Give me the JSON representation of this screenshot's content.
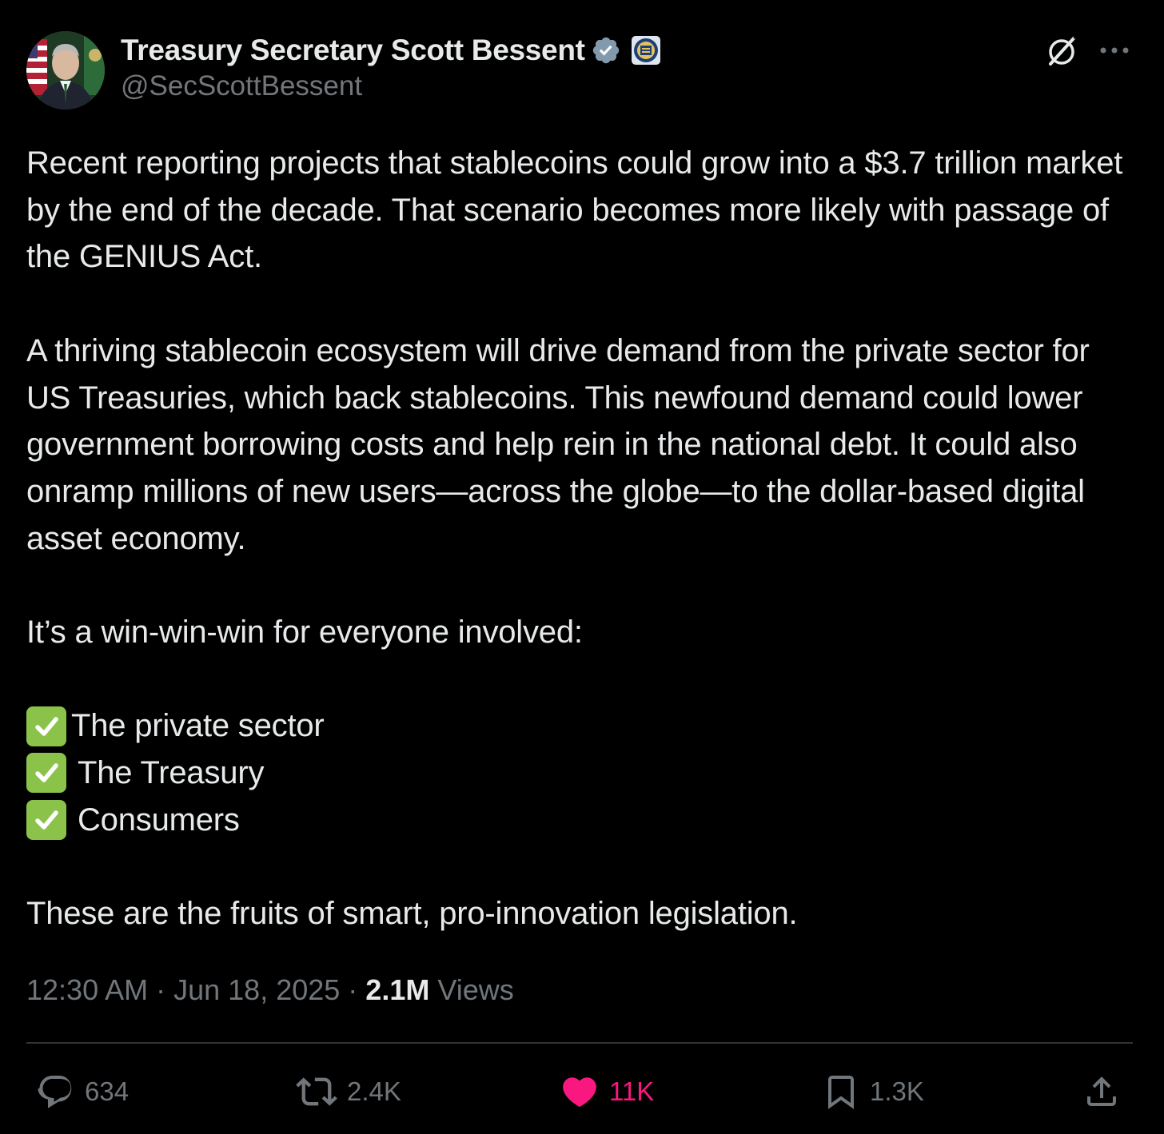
{
  "author": {
    "display_name": "Treasury Secretary Scott Bessent",
    "handle": "@SecScottBessent",
    "verified_icon": "verified-badge-icon",
    "affiliation_icon": "treasury-seal-icon"
  },
  "header_actions": {
    "grok_icon": "grok-icon",
    "more_icon": "more-options-icon"
  },
  "body": {
    "paragraph_1": "Recent reporting projects that stablecoins could grow into a $3.7 trillion market by the end of the decade. That scenario becomes more likely with passage of the GENIUS Act.",
    "paragraph_2": "A thriving stablecoin ecosystem will drive demand from the private sector for US Treasuries, which back stablecoins. This newfound demand could lower government borrowing costs and help rein in the national debt. It could also onramp millions of new users—across the globe—to the dollar-based digital asset economy.",
    "paragraph_3": "It’s a win-win-win for everyone involved:",
    "checklist": [
      "The private sector",
      "The Treasury",
      "Consumers"
    ],
    "paragraph_4": "These are the fruits of smart, pro-innovation legislation."
  },
  "meta": {
    "time": "12:30 AM",
    "separator": "·",
    "date": "Jun 18, 2025",
    "views_count": "2.1M",
    "views_label": "Views"
  },
  "actions": {
    "replies": "634",
    "reposts": "2.4K",
    "likes": "11K",
    "bookmarks": "1.3K"
  },
  "colors": {
    "background": "#000000",
    "text": "#e7e9ea",
    "secondary": "#71767b",
    "like": "#f91880",
    "verified": "#829aab",
    "divider": "#2f3336",
    "check_emoji": "#8bc34a"
  }
}
